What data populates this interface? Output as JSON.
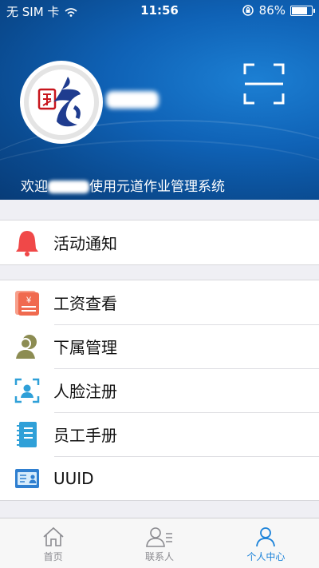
{
  "status_bar": {
    "carrier": "无 SIM 卡",
    "time": "11:56",
    "battery_percent": "86%",
    "battery_level": 0.86
  },
  "header": {
    "welcome_prefix": "欢迎",
    "welcome_suffix": "使用元道作业管理系统",
    "background_color": "#0f62b6",
    "icons": {
      "scan": "scan-icon"
    }
  },
  "menu_groups": [
    {
      "items": [
        {
          "label": "活动通知",
          "icon": "bell-icon",
          "color": "#f04848"
        }
      ]
    },
    {
      "items": [
        {
          "label": "工资查看",
          "icon": "salary-icon",
          "color": "#f06a4f"
        },
        {
          "label": "下属管理",
          "icon": "subordinate-icon",
          "color": "#8c8c52"
        },
        {
          "label": "人脸注册",
          "icon": "face-id-icon",
          "color": "#2fa0d8"
        },
        {
          "label": "员工手册",
          "icon": "handbook-icon",
          "color": "#2fa0d8"
        },
        {
          "label": "UUID",
          "icon": "id-card-icon",
          "color": "#2f7fd0"
        }
      ]
    }
  ],
  "tab_bar": {
    "active_color": "#1a82d9",
    "tabs": [
      {
        "label": "首页",
        "icon": "home-icon",
        "active": false
      },
      {
        "label": "联系人",
        "icon": "contacts-icon",
        "active": false
      },
      {
        "label": "个人中心",
        "icon": "person-icon",
        "active": true
      }
    ]
  }
}
